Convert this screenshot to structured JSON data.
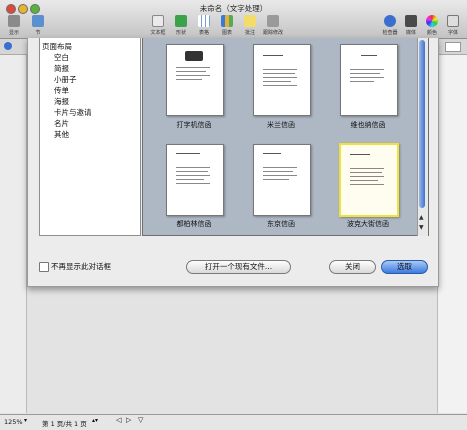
{
  "window": {
    "title": "未命名（文字处理）"
  },
  "toolbar": {
    "left": [
      {
        "label": "显示"
      },
      {
        "label": "节"
      }
    ],
    "center": [
      {
        "label": "文本框",
        "icon": "textbox-icon"
      },
      {
        "label": "形状",
        "icon": "shape-icon"
      },
      {
        "label": "表格",
        "icon": "table-icon"
      },
      {
        "label": "图表",
        "icon": "chart-icon"
      },
      {
        "label": "批注",
        "icon": "comment-icon"
      },
      {
        "label": "跟踪修改",
        "icon": "track-changes-icon"
      }
    ],
    "right": [
      {
        "label": "检查器",
        "icon": "inspector-icon"
      },
      {
        "label": "媒体",
        "icon": "media-icon"
      },
      {
        "label": "颜色",
        "icon": "color-icon"
      },
      {
        "label": "字体",
        "icon": "font-icon"
      }
    ]
  },
  "categories": {
    "header": "页面布局",
    "items": [
      "空白",
      "简报",
      "小册子",
      "传单",
      "海报",
      "卡片与邀请",
      "名片",
      "其他"
    ]
  },
  "templates": [
    {
      "name": "打字机信函",
      "selected": false
    },
    {
      "name": "米兰信函",
      "selected": false
    },
    {
      "name": "维也纳信函",
      "selected": false
    },
    {
      "name": "都柏林信函",
      "selected": false
    },
    {
      "name": "东京信函",
      "selected": false
    },
    {
      "name": "波克大街信函",
      "selected": true
    }
  ],
  "footer": {
    "dont_show": "不再显示此对话框",
    "open_existing": "打开一个现有文件...",
    "close": "关闭",
    "choose": "选取"
  },
  "statusbar": {
    "zoom": "125%",
    "page_info": "第 1 页/共 1 页"
  },
  "colors": {
    "accent": "#3b7be0",
    "selection": "#f0e23a",
    "gallery_bg": "#aeb8c4"
  }
}
